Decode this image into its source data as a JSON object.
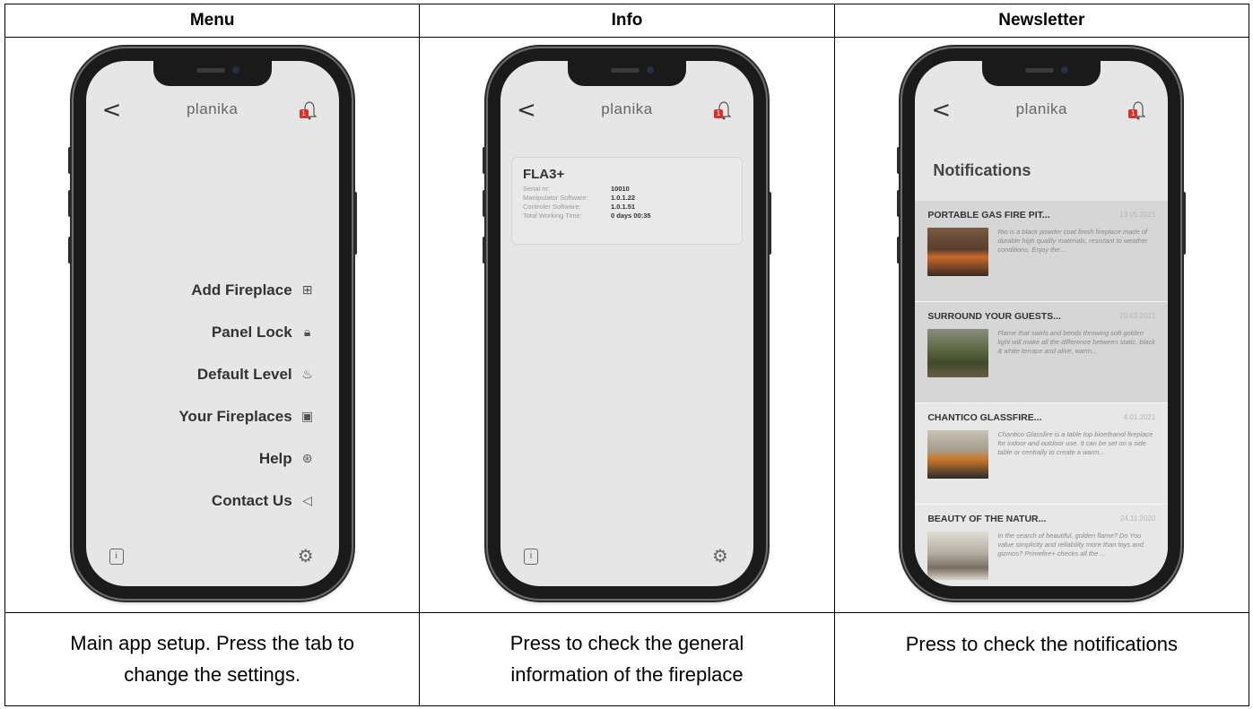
{
  "headers": [
    "Menu",
    "Info",
    "Newsletter"
  ],
  "captions": [
    [
      "Main app setup. Press the tab to",
      "change the settings."
    ],
    [
      "Press to check the general",
      "information of the fireplace"
    ],
    [
      "Press to check the notifications"
    ]
  ],
  "app": {
    "brand": "planika",
    "back_glyph": "<",
    "badge": "1"
  },
  "menu": {
    "items": [
      {
        "label": "Add Fireplace",
        "icon": "⊞"
      },
      {
        "label": "Panel Lock",
        "icon": "🔒︎"
      },
      {
        "label": "Default Level",
        "icon": "♨"
      },
      {
        "label": "Your Fireplaces",
        "icon": "▣"
      },
      {
        "label": "Help",
        "icon": "⊛"
      },
      {
        "label": "Contact Us",
        "icon": "◁"
      }
    ],
    "info_glyph": "i",
    "gear_glyph": "⚙"
  },
  "info": {
    "model": "FLA3+",
    "rows": [
      {
        "k": "Serial nr:",
        "v": "10010"
      },
      {
        "k": "Manipulator Software:",
        "v": "1.0.1.22"
      },
      {
        "k": "Controler Software:",
        "v": "1.0.1.51"
      },
      {
        "k": "Total Working Time:",
        "v": "0 days  00:35"
      }
    ]
  },
  "newsletter": {
    "title": "Notifications",
    "items": [
      {
        "title": "PORTABLE GAS FIRE PIT...",
        "date": "13.05.2021",
        "text": "Rio is a black powder coat finish fireplace made of durable high quality materials, resistant to weather conditions. Enjoy the..."
      },
      {
        "title": "SURROUND YOUR GUESTS...",
        "date": "20.03.2021",
        "text": "Flame that swirls and bends throwing soft golden light will make all the difference between static, black & white terrace and alive, warm..."
      },
      {
        "title": "CHANTICO GLASSFIRE...",
        "date": "4.01.2021",
        "text": "Chantico Glassfire is a table top bioethanol fireplace for indoor and outdoor use. It can be set on a side table or centrally to create a warm..."
      },
      {
        "title": "BEAUTY OF THE NATUR...",
        "date": "24.11.2020",
        "text": "In the search of beautiful, golden flame? Do You value simplicity and reliability more than toys and gizmos? Primefire+ checks all the ..."
      }
    ]
  }
}
